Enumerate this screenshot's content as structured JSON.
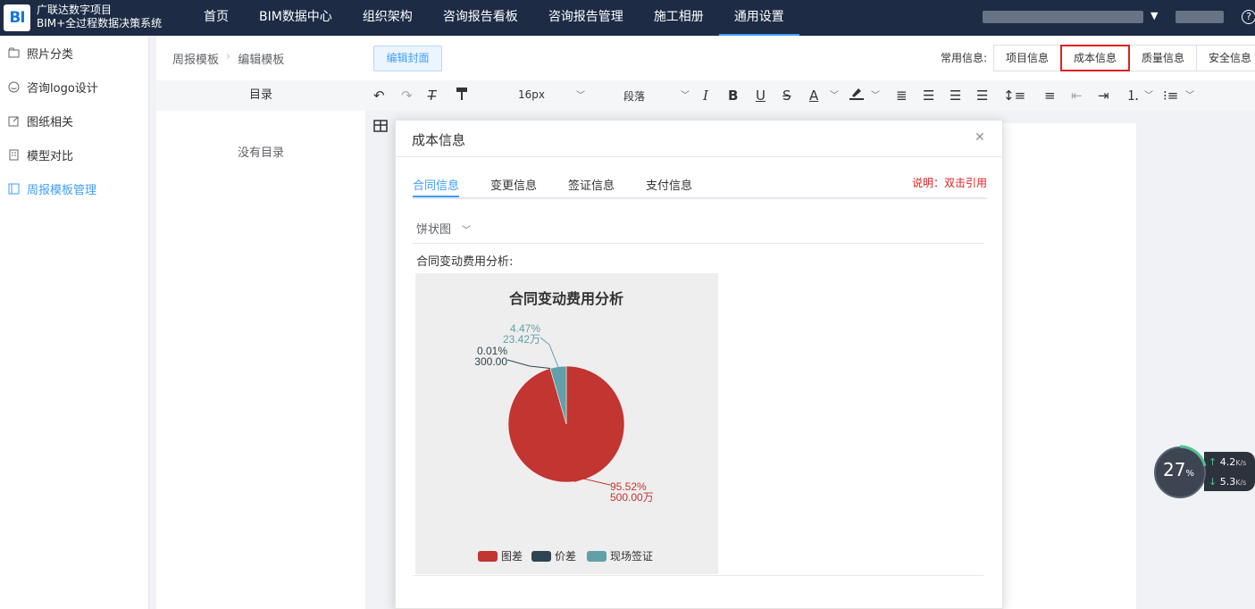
{
  "brand": {
    "logo_text": "BI",
    "line1": "广联达数字项目",
    "line2": "BIM+全过程数据决策系统"
  },
  "nav": [
    {
      "label": "首页"
    },
    {
      "label": "BIM数据中心"
    },
    {
      "label": "组织架构"
    },
    {
      "label": "咨询报告看板"
    },
    {
      "label": "咨询报告管理"
    },
    {
      "label": "施工相册"
    },
    {
      "label": "通用设置"
    }
  ],
  "sidebar": [
    {
      "label": "照片分类",
      "icon": "folder-icon"
    },
    {
      "label": "咨询logo设计",
      "icon": "palette-icon"
    },
    {
      "label": "图纸相关",
      "icon": "edit-icon"
    },
    {
      "label": "模型对比",
      "icon": "building-icon"
    },
    {
      "label": "周报模板管理",
      "icon": "template-icon"
    }
  ],
  "breadcrumb": [
    "周报模板",
    "编辑模板"
  ],
  "edit_cover_label": "编辑封面",
  "common_info_label": "常用信息:",
  "info_tabs": [
    "项目信息",
    "成本信息",
    "质量信息",
    "安全信息"
  ],
  "toc": {
    "header": "目录",
    "empty": "没有目录"
  },
  "toolbar": {
    "font_size": "16px",
    "paragraph": "段落"
  },
  "dialog": {
    "title": "成本信息",
    "tabs": [
      "合同信息",
      "变更信息",
      "签证信息",
      "支付信息"
    ],
    "note": "说明：双击引用",
    "chart_type_select": "饼状图",
    "chart_caption": "合同变动费用分析:"
  },
  "chart_data": {
    "type": "pie",
    "title": "合同变动费用分析",
    "categories": [
      "图差",
      "价差",
      "现场签证"
    ],
    "values": [
      500.0,
      0.03,
      23.42
    ],
    "labels": [
      {
        "percent": "95.52%",
        "value": "500.00万"
      },
      {
        "percent": "0.01%",
        "value": "300.00"
      },
      {
        "percent": "4.47%",
        "value": "23.42万"
      }
    ],
    "colors": [
      "#c23531",
      "#2f4554",
      "#61a0a8"
    ],
    "legend_position": "bottom"
  },
  "net_widget": {
    "percent": "27",
    "percent_unit": "%",
    "up": "4.2",
    "down": "5.3",
    "unit": "K/s"
  }
}
